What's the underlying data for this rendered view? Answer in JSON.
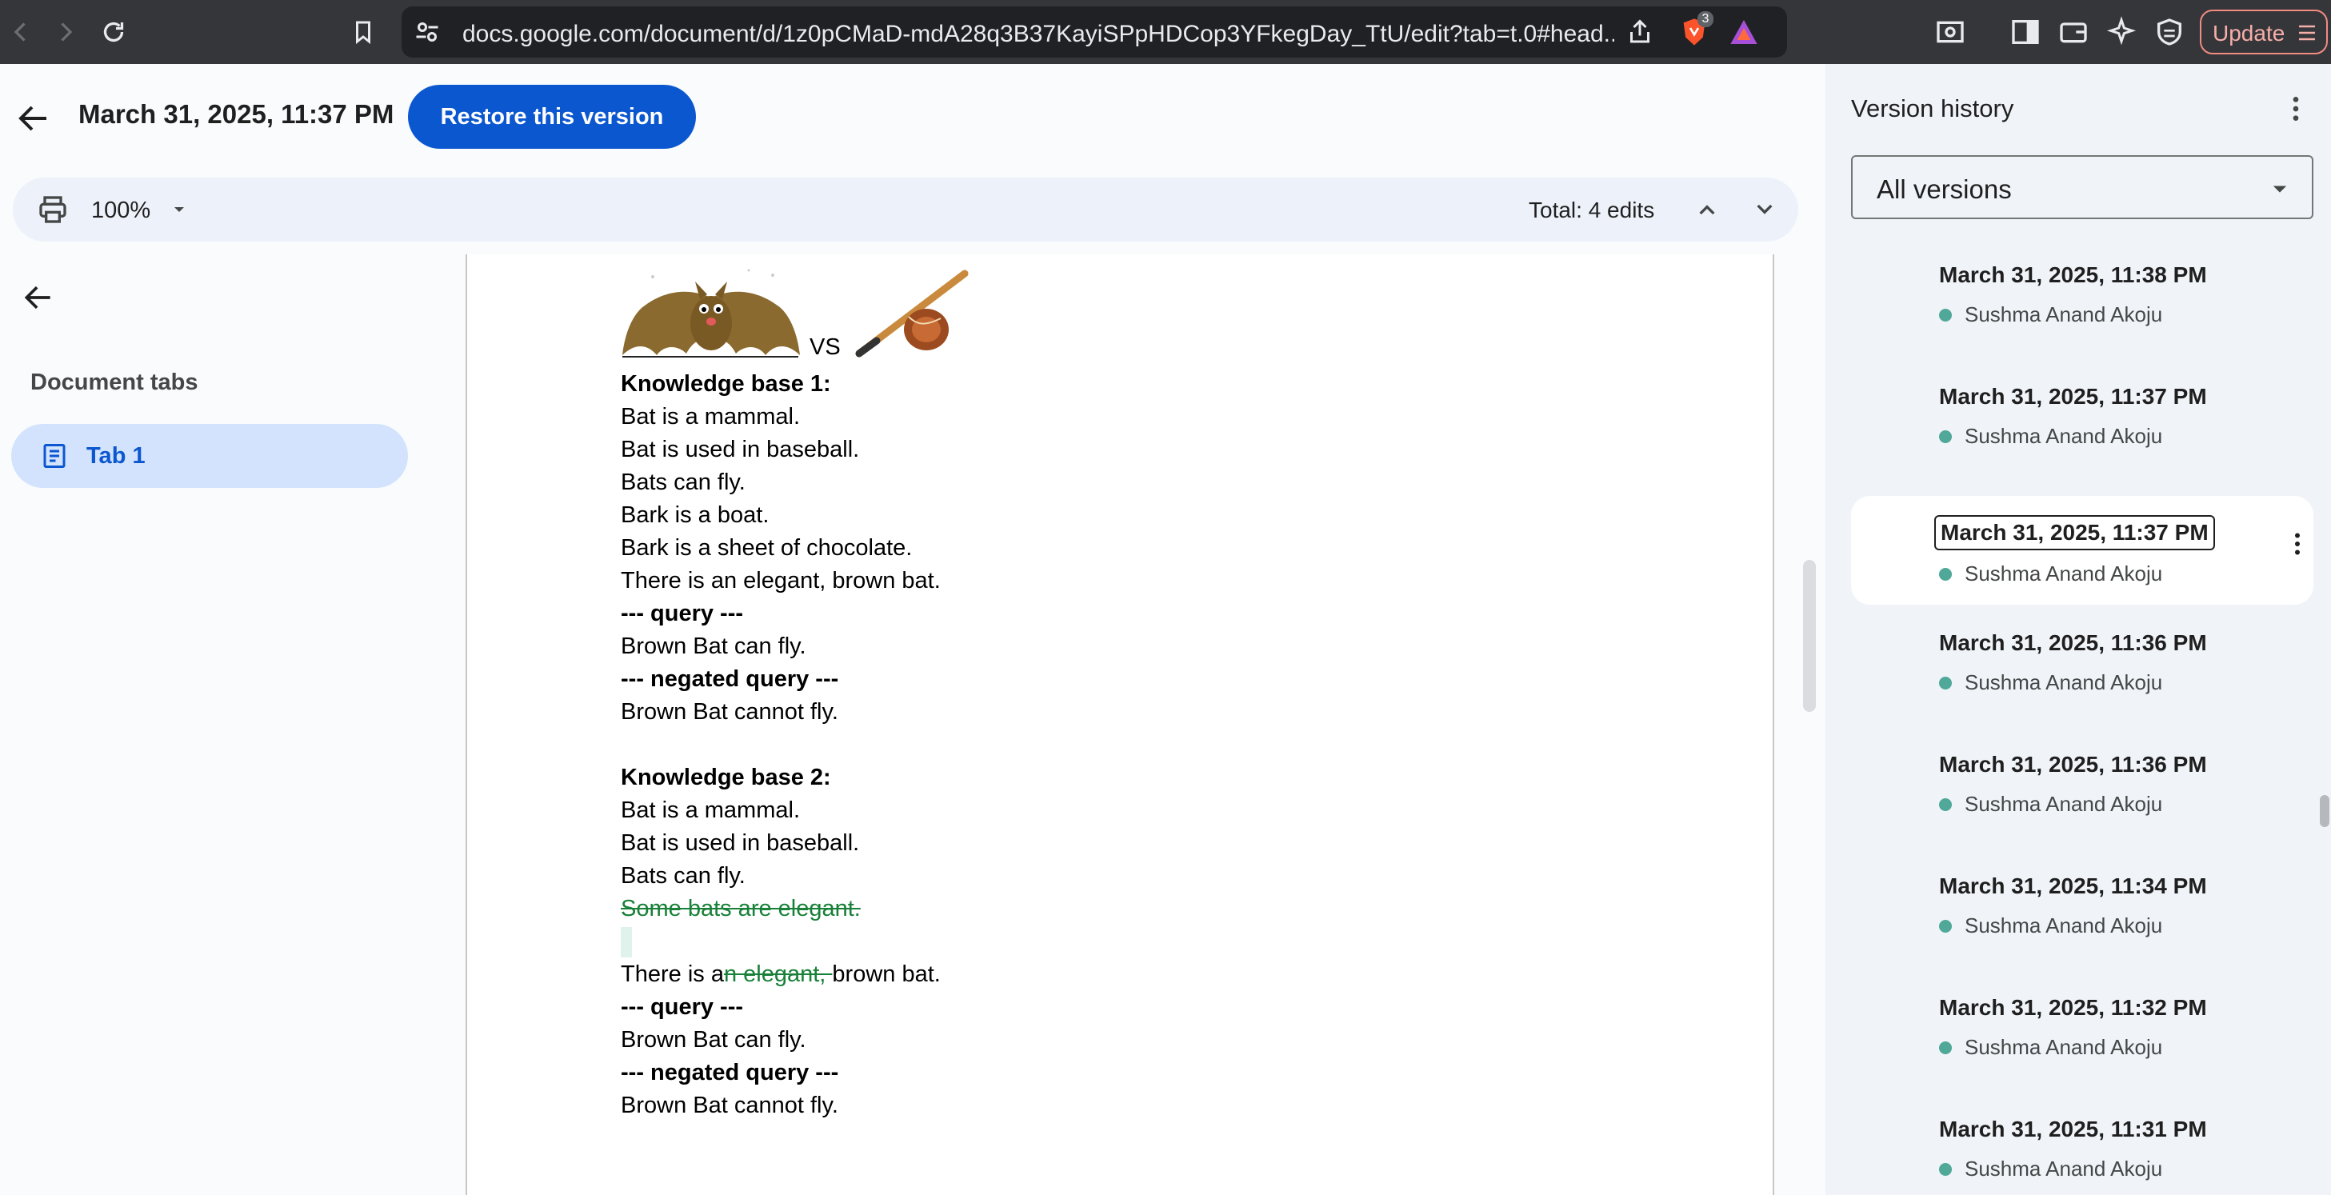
{
  "browser": {
    "url": "docs.google.com/document/d/1z0pCMaD-mdA28q3B37KayiSPpHDCop3YFkegDay_TtU/edit?tab=t.0#head...",
    "brave_badge_count": "3",
    "update_label": "Update"
  },
  "header": {
    "version_title": "March 31, 2025, 11:37 PM",
    "restore_label": "Restore this version"
  },
  "toolbar": {
    "zoom": "100%",
    "total_edits": "Total: 4 edits"
  },
  "left_panel": {
    "heading": "Document tabs",
    "tabs": [
      {
        "label": "Tab 1"
      }
    ]
  },
  "document": {
    "vs_text": "VS",
    "kb1": {
      "heading": "Knowledge base 1:",
      "lines": [
        "Bat is a mammal.",
        "Bat is used in baseball.",
        "Bats can fly.",
        "Bark is a boat.",
        "Bark is a sheet of chocolate.",
        "There is an elegant, brown bat."
      ],
      "query_label": "--- query ---",
      "query": "Brown Bat can fly.",
      "negated_label": "--- negated query ---",
      "negated": "Brown Bat cannot fly."
    },
    "kb2": {
      "heading": "Knowledge base 2:",
      "lines": [
        "Bat is a mammal.",
        "Bat is used in baseball.",
        "Bats can fly."
      ],
      "deleted_line": "Some bats are elegant.",
      "edited_line": {
        "before": "There is a",
        "deleted": "n elegant, ",
        "after": "brown bat."
      },
      "query_label": "--- query ---",
      "query": "Brown Bat can fly.",
      "negated_label": "--- negated query ---",
      "negated": "Brown Bat cannot fly."
    }
  },
  "version_history": {
    "title": "Version history",
    "filter": "All versions",
    "user_color": "#4fa898",
    "versions": [
      {
        "date": "March 31, 2025, 11:38 PM",
        "user": "Sushma Anand Akoju"
      },
      {
        "date": "March 31, 2025, 11:37 PM",
        "user": "Sushma Anand Akoju"
      },
      {
        "date": "March 31, 2025, 11:37 PM",
        "user": "Sushma Anand Akoju",
        "selected": true
      },
      {
        "date": "March 31, 2025, 11:36 PM",
        "user": "Sushma Anand Akoju"
      },
      {
        "date": "March 31, 2025, 11:36 PM",
        "user": "Sushma Anand Akoju"
      },
      {
        "date": "March 31, 2025, 11:34 PM",
        "user": "Sushma Anand Akoju"
      },
      {
        "date": "March 31, 2025, 11:32 PM",
        "user": "Sushma Anand Akoju"
      },
      {
        "date": "March 31, 2025, 11:31 PM",
        "user": "Sushma Anand Akoju"
      }
    ]
  },
  "colors": {
    "accent": "#0b57d0",
    "deleted_text": "#188038",
    "tab_active_bg": "#d3e3fd"
  }
}
